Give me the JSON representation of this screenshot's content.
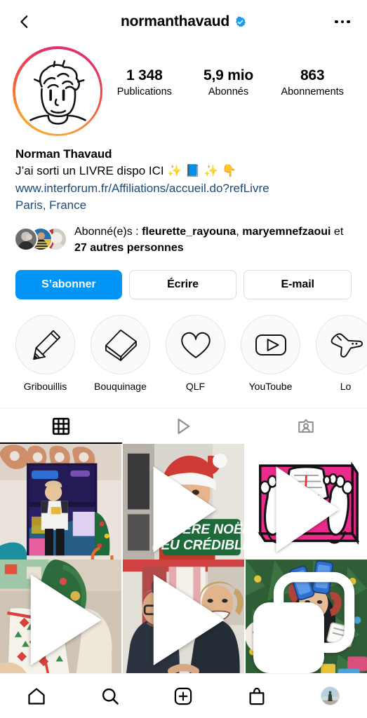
{
  "header": {
    "back_icon": "chevron-left-icon",
    "username": "normanthavaud",
    "verified_icon": "verified-badge-icon",
    "more_icon": "more-options-icon"
  },
  "profile": {
    "avatar_alt": "profile-picture",
    "has_story_ring": true,
    "ring_colors": [
      "#E1306C",
      "#F15742",
      "#FBB040"
    ],
    "stats": [
      {
        "value": "1 348",
        "label": "Publications"
      },
      {
        "value": "5,9 mio",
        "label": "Abonnés"
      },
      {
        "value": "863",
        "label": "Abonnements"
      }
    ]
  },
  "bio": {
    "full_name": "Norman Thavaud",
    "description": "J’ai sorti un LIVRE dispo ICI ✨ 📘 ✨ 👇",
    "link": "www.interforum.fr/Affiliations/accueil.do?refLivre",
    "location": "Paris, France",
    "link_color": "#1B4A7D"
  },
  "followed_by": {
    "prefix": "Abonné(e)s : ",
    "names": [
      "fleurette_rayouna",
      "maryemnefzaoui"
    ],
    "separator": ", ",
    "connector": " et ",
    "others": "27 autres personnes"
  },
  "actions": [
    {
      "label": "S’abonner",
      "style": "primary",
      "color": "#0095F6",
      "name": "follow-button"
    },
    {
      "label": "Écrire",
      "style": "secondary",
      "name": "message-button"
    },
    {
      "label": "E-mail",
      "style": "secondary",
      "name": "email-button"
    }
  ],
  "highlights": [
    {
      "label": "Gribouillis",
      "icon": "pencil-icon"
    },
    {
      "label": "Bouquinage",
      "icon": "book-icon"
    },
    {
      "label": "QLF",
      "icon": "heart-icon"
    },
    {
      "label": "YouToube",
      "icon": "play-rectangle-icon"
    },
    {
      "label": "Lo",
      "icon": "airplane-icon"
    }
  ],
  "tabs": [
    {
      "name": "grid",
      "icon": "grid-icon",
      "active": true
    },
    {
      "name": "reels",
      "icon": "play-triangle-icon",
      "active": false
    },
    {
      "name": "tagged",
      "icon": "tagged-person-icon",
      "active": false
    }
  ],
  "grid_posts": [
    {
      "caption": "2022 balloons with person in front of mirror",
      "badge": "none"
    },
    {
      "caption": "LE PÈRE NOËL PEU CRÉDIBLE",
      "overlay_text_line1": "LE PÈRE NOËL",
      "overlay_text_line2": "PEU CRÉDIBLE",
      "badge": "reel-icon"
    },
    {
      "caption": "Illustration of feet on a pink bathroom scale",
      "badge": "reel-icon"
    },
    {
      "caption": "Christmas wrapped gift under the tree",
      "badge": "play-icon"
    },
    {
      "caption": "Two men laughing on a sofa",
      "badge": "play-icon"
    },
    {
      "caption": "Person with iPhones lying by a Christmas tree",
      "badge": "carousel-icon"
    }
  ],
  "bottom_nav": [
    {
      "name": "home",
      "icon": "home-icon"
    },
    {
      "name": "search",
      "icon": "search-icon"
    },
    {
      "name": "create",
      "icon": "plus-square-icon"
    },
    {
      "name": "shop",
      "icon": "shopping-bag-icon"
    },
    {
      "name": "profile",
      "icon": "profile-avatar-icon"
    }
  ]
}
